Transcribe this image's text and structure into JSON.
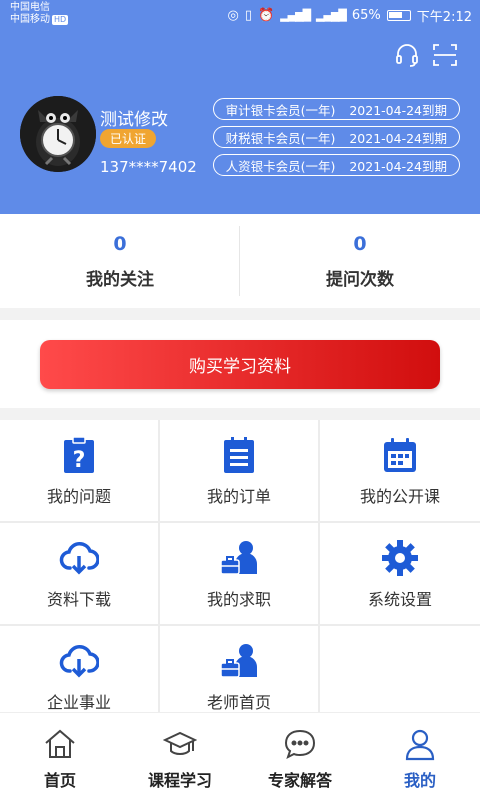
{
  "status_bar": {
    "carrier_1": "中国电信",
    "carrier_2": "中国移动",
    "hd_badge": "HD",
    "battery": "65%",
    "time": "下午2:12"
  },
  "header": {
    "username": "测试修改",
    "verified": "已认证",
    "phone": "137****7402",
    "memberships": [
      {
        "name": "审计银卡会员(一年)",
        "expiry": "2021-04-24到期"
      },
      {
        "name": "财税银卡会员(一年)",
        "expiry": "2021-04-24到期"
      },
      {
        "name": "人资银卡会员(一年)",
        "expiry": "2021-04-24到期"
      }
    ]
  },
  "stats": [
    {
      "value": "0",
      "label": "我的关注"
    },
    {
      "value": "0",
      "label": "提问次数"
    }
  ],
  "buy_button": "购买学习资料",
  "grid": [
    {
      "label": "我的问题",
      "icon": "question-clipboard-icon"
    },
    {
      "label": "我的订单",
      "icon": "order-list-icon"
    },
    {
      "label": "我的公开课",
      "icon": "calendar-icon"
    },
    {
      "label": "资料下载",
      "icon": "cloud-download-icon"
    },
    {
      "label": "我的求职",
      "icon": "job-seeker-icon"
    },
    {
      "label": "系统设置",
      "icon": "gear-icon"
    },
    {
      "label": "企业事业",
      "icon": "cloud-download-icon"
    },
    {
      "label": "老师首页",
      "icon": "teacher-icon"
    }
  ],
  "tabs": [
    {
      "label": "首页",
      "icon": "home-icon"
    },
    {
      "label": "课程学习",
      "icon": "graduation-cap-icon"
    },
    {
      "label": "专家解答",
      "icon": "chat-bubble-icon"
    },
    {
      "label": "我的",
      "icon": "user-icon",
      "active": true
    }
  ],
  "colors": {
    "header": "#5f8be8",
    "accent": "#2a5fc4",
    "buy": "#e01b1b",
    "badge": "#f0a531"
  }
}
